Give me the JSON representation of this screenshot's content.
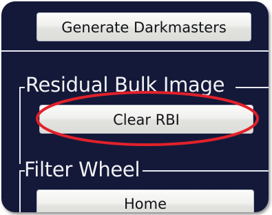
{
  "buttons": {
    "generate_darkmasters": "Generate Darkmasters",
    "clear_rbi": "Clear RBI",
    "home": "Home"
  },
  "sections": {
    "residual_bulk_image": "Residual Bulk Image",
    "filter_wheel": "Filter Wheel"
  },
  "colors": {
    "panel_background": "#14193a",
    "highlight_ellipse": "#e2212a",
    "divider_line": "#e9eaf0"
  }
}
